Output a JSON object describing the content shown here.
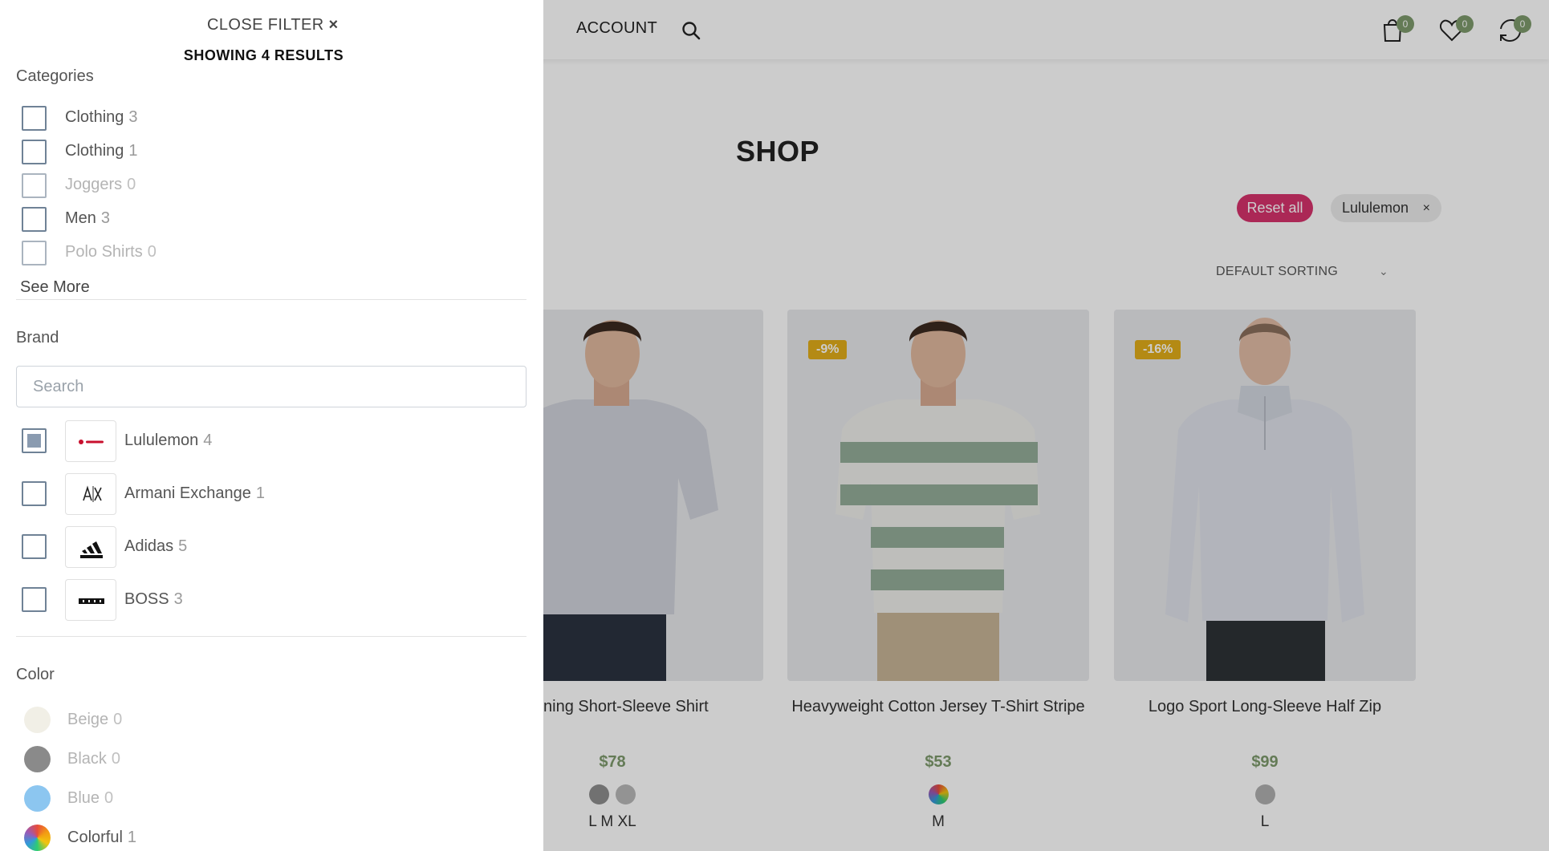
{
  "header": {
    "account_label": "ACCOUNT",
    "icons": [
      "search-icon",
      "cart-icon",
      "heart-icon",
      "compare-icon"
    ],
    "cart_count": "0",
    "wishlist_count": "0",
    "compare_count": "0",
    "badge_color": "#7e9a6c"
  },
  "shop": {
    "title": "SHOP",
    "reset_label": "Reset all",
    "active_filter": "Lululemon",
    "active_filter_remove": "×",
    "sorting_label": "DEFAULT SORTING",
    "accent_color": "#d6336c",
    "price_color": "#7e9a6c",
    "discount_color": "#e2ad19"
  },
  "products": [
    {
      "name": "Training Short-Sleeve Shirt",
      "price": "$78",
      "discount": "",
      "swatches": [
        "#8e8e8e",
        "#b8b8b8"
      ],
      "sizes": "L M XL"
    },
    {
      "name": "Heavyweight Cotton Jersey T-Shirt Stripe",
      "price": "$53",
      "discount": "-9%",
      "swatches": [
        "multicolor"
      ],
      "sizes": "M"
    },
    {
      "name": "Logo Sport Long-Sleeve Half Zip",
      "price": "$99",
      "discount": "-16%",
      "swatches": [
        "#b0b0b0"
      ],
      "sizes": "L"
    }
  ],
  "filter": {
    "close_label": "CLOSE FILTER",
    "close_icon": "×",
    "showing": "SHOWING 4 RESULTS",
    "categories": {
      "title": "Categories",
      "items": [
        {
          "label": "Clothing",
          "count": "3"
        },
        {
          "label": "Clothing",
          "count": "1"
        },
        {
          "label": "Joggers",
          "count": "0"
        },
        {
          "label": "Men",
          "count": "3"
        },
        {
          "label": "Polo Shirts",
          "count": "0"
        }
      ],
      "see_more": "See More"
    },
    "brand": {
      "title": "Brand",
      "search_placeholder": "Search",
      "items": [
        {
          "label": "Lululemon",
          "count": "4",
          "logo": "lululemon",
          "checked": true
        },
        {
          "label": "Armani Exchange",
          "count": "1",
          "logo": "A|X",
          "checked": false
        },
        {
          "label": "Adidas",
          "count": "5",
          "logo": "adidas",
          "checked": false
        },
        {
          "label": "BOSS",
          "count": "3",
          "logo": "BOSS",
          "checked": false
        }
      ]
    },
    "color": {
      "title": "Color",
      "items": [
        {
          "label": "Beige",
          "count": "0",
          "hex": "#f1efe6"
        },
        {
          "label": "Black",
          "count": "0",
          "hex": "#8a8a8a"
        },
        {
          "label": "Blue",
          "count": "0",
          "hex": "#8cc6f0"
        },
        {
          "label": "Colorful",
          "count": "1",
          "hex": "multicolor"
        }
      ]
    }
  }
}
